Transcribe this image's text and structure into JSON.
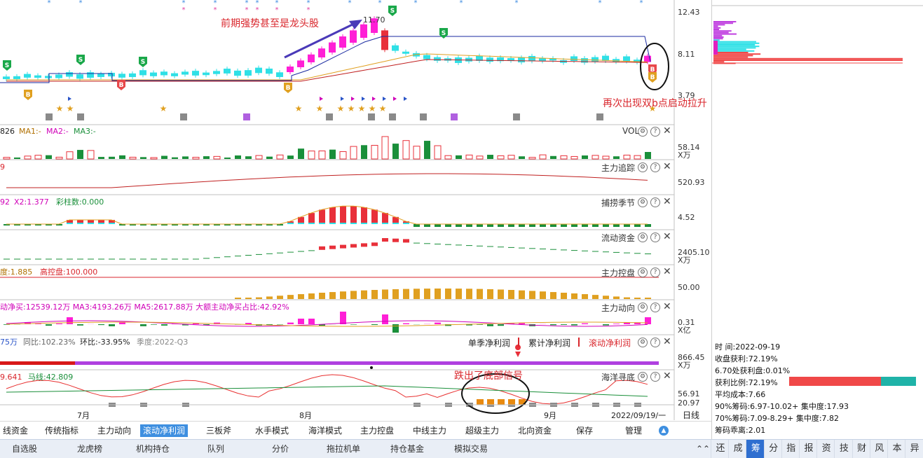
{
  "annotations": {
    "top_note": "前期强势甚至是龙头股",
    "right_note": "再次出现双b点启动拉升",
    "bottom_note": "跌出了底部信号"
  },
  "price_axis": [
    "12.43",
    "8.11",
    "3.79"
  ],
  "price_peak_label": "11.70",
  "vol_panel": {
    "prefix": "826",
    "ma1": "MA1:-",
    "ma2": "MA2:-",
    "ma3": "MA3:-",
    "title": "VOL",
    "axis_value": "58.14",
    "axis_unit": "X万"
  },
  "zhuli_zhuizong": {
    "prefix": "9",
    "title": "主力追踪",
    "axis_value": "520.93"
  },
  "bulao_jijie": {
    "prefix": "92",
    "x2": "X2:1.377",
    "caizhu": "彩柱数:0.000",
    "title": "捕捞季节",
    "axis_value": "4.52"
  },
  "liudong_zijin": {
    "title": "流动资金",
    "axis_value": "2405.10",
    "axis_unit": "X万"
  },
  "zhuli_kongpan": {
    "prefix": "度:1.885",
    "gaokongpan": "高控盘:100.000",
    "title": "主力控盘",
    "axis_value": "50.00"
  },
  "zhuli_dongxiang": {
    "text": "动净买:12539.12万  MA3:4193.26万  MA5:2617.88万  大额主动净买占比:42.92%",
    "title": "主力动向",
    "axis_value": "0.31",
    "axis_unit": "X亿"
  },
  "profit_panel": {
    "prefix": "75万",
    "tongbi": "同比:102.23%",
    "huanbi": "环比:-33.95%",
    "jidu": "季度:2022-Q3",
    "tab1": "单季净利润",
    "tab2": "累计净利润",
    "tab3": "滚动净利润",
    "axis_value": "866.45",
    "axis_unit": "X万"
  },
  "haiyang_xundi": {
    "prefix": "9.641",
    "maxian": "马线:42.809",
    "title": "海洋寻底",
    "axis_value": "56.91",
    "axis_value2": "20.97"
  },
  "date_axis": {
    "m7": "7月",
    "m8": "8月",
    "m9": "9月",
    "current": "2022/09/19/一",
    "period": "日线"
  },
  "bottom_tabs": [
    "线资金",
    "传统指标",
    "主力动向",
    "滚动净利润",
    "三板斧",
    "水手模式",
    "海洋模式",
    "主力控盘",
    "中线主力",
    "超级主力",
    "北向资金",
    "保存",
    "管理"
  ],
  "bottom_tab_active": "滚动净利润",
  "footer_tabs": [
    "自选股",
    "龙虎榜",
    "机构持仓",
    "队列",
    "分价",
    "拖拉机单",
    "持仓基金",
    "模拟交易"
  ],
  "footer_right_tabs": [
    "还",
    "成",
    "筹",
    "分",
    "指",
    "报",
    "资",
    "技",
    "财",
    "风",
    "本",
    "异"
  ],
  "footer_right_active": "筹",
  "chip_info": {
    "time_label": "时      间:",
    "time_value": "2022-09-19",
    "profit_label": "收盘获利:",
    "profit_value": "72.19%",
    "p670": "6.70处获利盘:0.01%",
    "ratio_label": "获利比例:",
    "ratio_value": "72.19%",
    "ratio_fraction": 0.7219,
    "avg_cost": "平均成本:7.66",
    "c90": "90%筹码:6.97-10.02+ 集中度:17.93",
    "c70": "70%筹码:7.09-8.29+ 集中度:7.82",
    "divergence": "筹码乖离:2.01"
  },
  "colors": {
    "up": "#e8303a",
    "down": "#1a8f3a",
    "cyan": "#2fe0e6",
    "magenta": "#ff1fd6",
    "navy": "#1a2aa0",
    "gold": "#e0a020"
  }
}
